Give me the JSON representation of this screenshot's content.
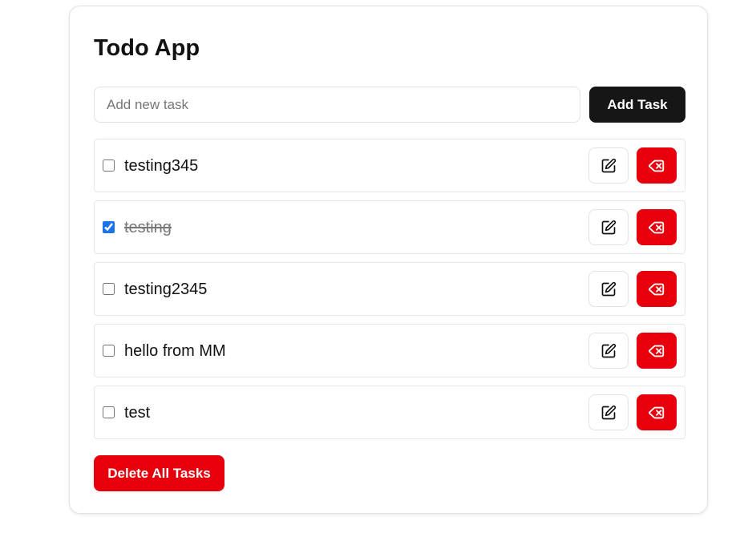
{
  "app": {
    "title": "Todo App"
  },
  "new_task": {
    "placeholder": "Add new task",
    "value": "",
    "add_label": "Add Task"
  },
  "tasks": [
    {
      "text": "testing345",
      "completed": false
    },
    {
      "text": "testing",
      "completed": true
    },
    {
      "text": "testing2345",
      "completed": false
    },
    {
      "text": "hello from MM",
      "completed": false
    },
    {
      "text": "test",
      "completed": false
    }
  ],
  "actions": {
    "delete_all_label": "Delete All Tasks",
    "edit_icon": "edit-icon",
    "delete_icon": "backspace-delete-icon"
  },
  "colors": {
    "primary_dark": "#161616",
    "danger": "#e7000b",
    "checkbox_accent": "#1a73e8"
  }
}
